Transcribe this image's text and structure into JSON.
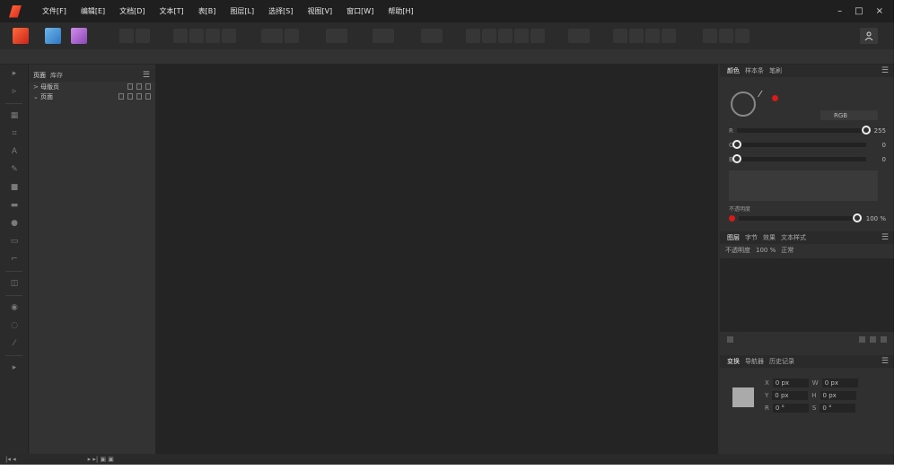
{
  "menubar": {
    "items": [
      "文件[F]",
      "编辑[E]",
      "文档[D]",
      "文本[T]",
      "表[B]",
      "图层[L]",
      "选择[S]",
      "视图[V]",
      "窗口[W]",
      "帮助[H]"
    ],
    "window_controls": [
      "–",
      "□",
      "×"
    ]
  },
  "icons": {
    "app": "affinity-publisher-logo-icon",
    "publisher": "publisher-persona-icon",
    "designer": "designer-persona-icon",
    "photo": "photo-persona-icon",
    "user": "user-icon"
  },
  "pages_panel": {
    "tabs": [
      "页面",
      "库存"
    ],
    "rows": [
      {
        "arrow": ">",
        "label": "母版页"
      },
      {
        "arrow": "⌄",
        "label": "页面"
      }
    ],
    "menu": "☰"
  },
  "color_panel": {
    "tabs": [
      "颜色",
      "样本条",
      "笔刷"
    ],
    "mode": "RGB",
    "sliders": [
      {
        "label": "R",
        "value": "255"
      },
      {
        "label": "G",
        "value": "0"
      },
      {
        "label": "B",
        "value": "0"
      }
    ],
    "opacity_label": "不透明度",
    "opacity_value": "100 %"
  },
  "layers_panel": {
    "tabs": [
      "图层",
      "字节",
      "效果",
      "文本样式"
    ],
    "opacity_label": "不透明度",
    "opacity_value": "100 %",
    "blend": "正常"
  },
  "transform_panel": {
    "tabs": [
      "变换",
      "导航器",
      "历史记录"
    ],
    "fields": [
      {
        "label": "X",
        "value": "0 px",
        "label2": "W",
        "value2": "0 px"
      },
      {
        "label": "Y",
        "value": "0 px",
        "label2": "H",
        "value2": "0 px"
      },
      {
        "label": "R",
        "value": "0 °",
        "label2": "S",
        "value2": "0 °"
      }
    ]
  },
  "colors": {
    "accent": "#d51b1b"
  }
}
